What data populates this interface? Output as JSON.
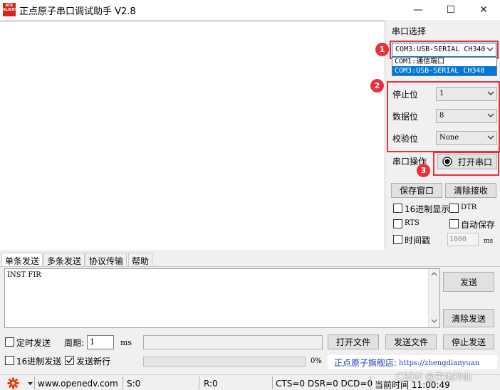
{
  "window": {
    "logo_text": "ATK\nALIENTEK",
    "title": "正点原子串口调试助手 V2.8",
    "minimize_label": "—",
    "maximize_label": "☐",
    "close_label": "✕"
  },
  "serial": {
    "port_label": "串口选择",
    "port_selected": "COM3:USB-SERIAL CH340",
    "port_options": [
      "COM1:通信端口",
      "COM3:USB-SERIAL CH340"
    ],
    "stopbits_label": "停止位",
    "stopbits_value": "1",
    "databits_label": "数据位",
    "databits_value": "8",
    "parity_label": "校验位",
    "parity_value": "None",
    "op_label": "串口操作",
    "open_button": "打开串口",
    "save_window_button": "保存窗口",
    "clear_receive_button": "清除接收",
    "hex_display_label": "16进制显示",
    "dtr_label": "DTR",
    "rts_label": "RTS",
    "autosave_label": "自动保存",
    "timestamp_label": "时间戳",
    "timestamp_value": "1000",
    "timestamp_unit": "ms"
  },
  "badges": [
    "1",
    "2",
    "3"
  ],
  "tabs": [
    "单条发送",
    "多条发送",
    "协议传输",
    "帮助"
  ],
  "send": {
    "text": "INST FIR",
    "send_button": "发送",
    "clear_send_button": "清除发送",
    "timed_send_label": "定时发送",
    "period_label": "周期:",
    "period_value": "1",
    "period_unit": "ms",
    "open_file_button": "打开文件",
    "send_file_button": "发送文件",
    "stop_send_button": "停止发送",
    "hex_send_label": "16进制发送",
    "send_newline_label": "发送新行",
    "progress_text": "0%",
    "progress": 0,
    "store_text": "正点原子旗舰店:",
    "store_url": "https://zhengdianyuan"
  },
  "status": {
    "website": "www.openedv.com",
    "s_count": "S:0",
    "r_count": "R:0",
    "signals": "CTS=0 DSR=0 DCD=0",
    "time": "当前时间 11:00:49",
    "watermark": "CSDN @天地神仙"
  },
  "colors": {
    "accent_red": "#e8313a",
    "selection_blue": "#0078d7",
    "link_blue": "#1a3fb8"
  }
}
